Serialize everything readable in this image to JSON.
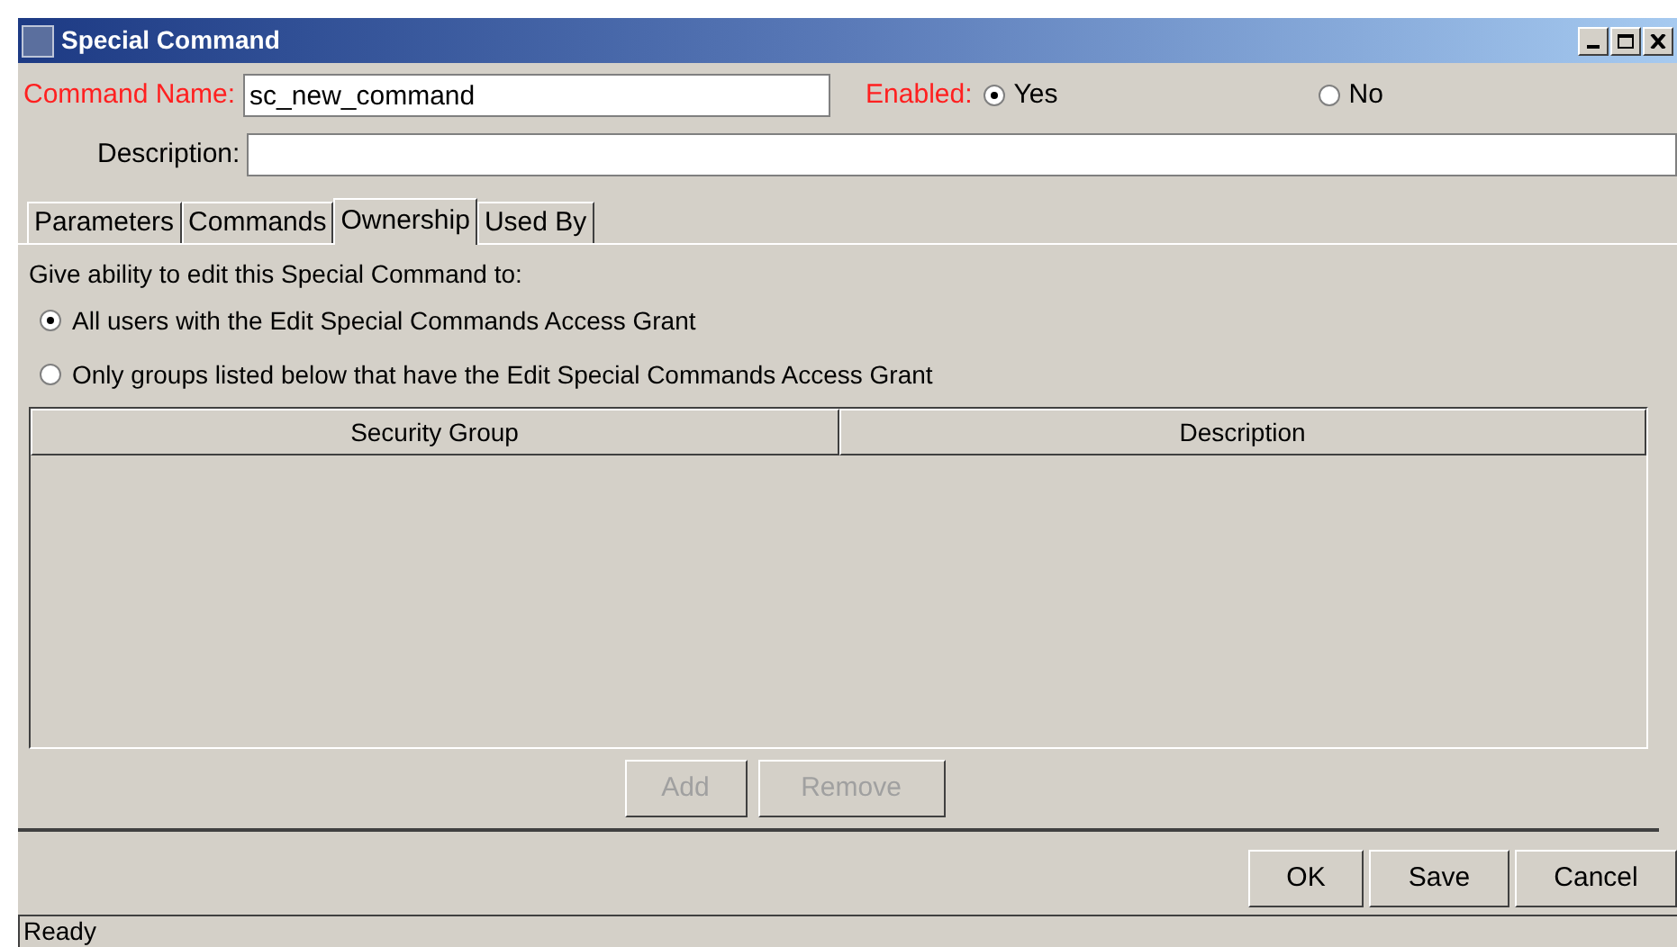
{
  "window": {
    "title": "Special Command"
  },
  "command_name": {
    "label": "Command Name:",
    "value": "sc_new_command"
  },
  "enabled": {
    "label": "Enabled:",
    "options": [
      {
        "label": "Yes",
        "selected": true
      },
      {
        "label": "No",
        "selected": false
      }
    ]
  },
  "description": {
    "label": "Description:"
  },
  "tabs": [
    {
      "label": "Parameters",
      "selected": false
    },
    {
      "label": "Commands",
      "selected": false
    },
    {
      "label": "Ownership",
      "selected": true
    },
    {
      "label": "Used By",
      "selected": false
    }
  ],
  "ownership": {
    "prompt": "Give ability to edit this Special Command to:",
    "options": [
      {
        "label": "All users with the Edit Special Commands Access Grant",
        "selected": true
      },
      {
        "label": "Only groups listed below that have the Edit Special Commands Access Grant",
        "selected": false
      }
    ]
  },
  "table": {
    "columns": [
      "Security Group",
      "Description"
    ]
  },
  "table_buttons": [
    {
      "label": "Add",
      "disabled": true
    },
    {
      "label": "Remove",
      "disabled": true
    }
  ],
  "buttons": [
    "OK",
    "Save",
    "Cancel"
  ],
  "status_bar": "Ready"
}
